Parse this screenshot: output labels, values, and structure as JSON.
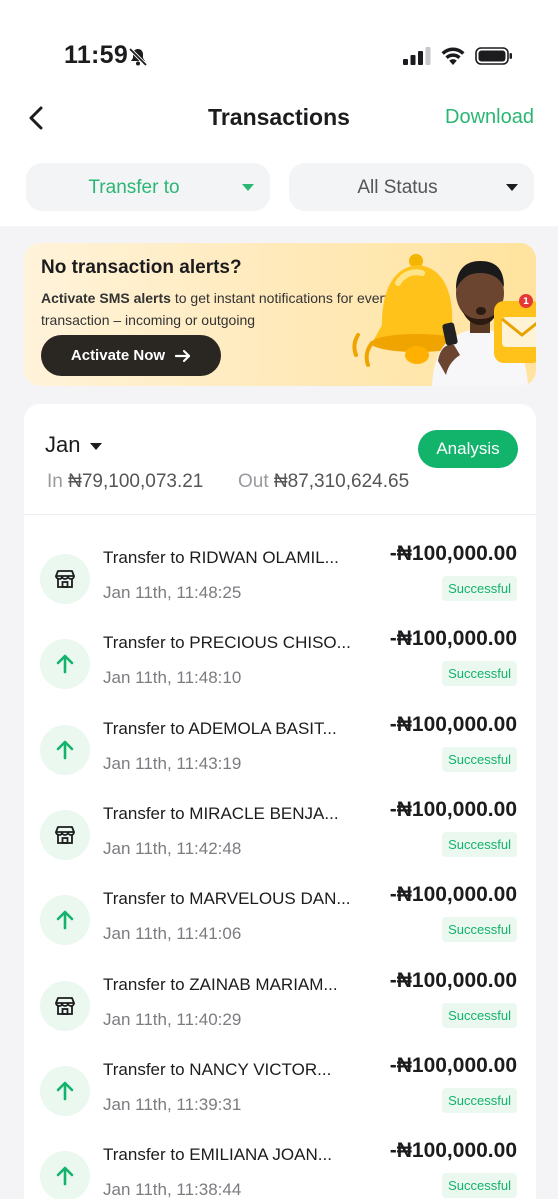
{
  "status_bar": {
    "time": "11:59"
  },
  "header": {
    "title": "Transactions",
    "download_label": "Download"
  },
  "filters": {
    "type": "Transfer to",
    "status": "All Status"
  },
  "banner": {
    "title": "No transaction alerts?",
    "text_bold": "Activate SMS alerts",
    "text_rest": " to get instant notifications for every transaction – incoming or outgoing",
    "button_label": "Activate Now",
    "badge_count": "1"
  },
  "summary": {
    "month": "Jan",
    "analysis_label": "Analysis",
    "in_label": "In",
    "in_value": "₦79,100,073.21",
    "out_label": "Out",
    "out_value": "₦87,310,624.65"
  },
  "transactions": [
    {
      "icon": "store-icon",
      "name": "Transfer to RIDWAN OLAMIL...",
      "time": "Jan 11th, 11:48:25",
      "amount": "-₦100,000.00",
      "status": "Successful"
    },
    {
      "icon": "arrow-up-icon",
      "name": "Transfer to PRECIOUS CHISO...",
      "time": "Jan 11th, 11:48:10",
      "amount": "-₦100,000.00",
      "status": "Successful"
    },
    {
      "icon": "arrow-up-icon",
      "name": "Transfer to ADEMOLA BASIT...",
      "time": "Jan 11th, 11:43:19",
      "amount": "-₦100,000.00",
      "status": "Successful"
    },
    {
      "icon": "store-icon",
      "name": "Transfer to MIRACLE BENJA...",
      "time": "Jan 11th, 11:42:48",
      "amount": "-₦100,000.00",
      "status": "Successful"
    },
    {
      "icon": "arrow-up-icon",
      "name": "Transfer to MARVELOUS DAN...",
      "time": "Jan 11th, 11:41:06",
      "amount": "-₦100,000.00",
      "status": "Successful"
    },
    {
      "icon": "store-icon",
      "name": "Transfer to ZAINAB MARIAM...",
      "time": "Jan 11th, 11:40:29",
      "amount": "-₦100,000.00",
      "status": "Successful"
    },
    {
      "icon": "arrow-up-icon",
      "name": "Transfer to NANCY VICTOR...",
      "time": "Jan 11th, 11:39:31",
      "amount": "-₦100,000.00",
      "status": "Successful"
    },
    {
      "icon": "arrow-up-icon",
      "name": "Transfer to EMILIANA JOAN...",
      "time": "Jan 11th, 11:38:44",
      "amount": "-₦100,000.00",
      "status": "Successful"
    }
  ],
  "colors": {
    "accent": "#12b36b",
    "accent_text": "#2bb673",
    "icon_bg": "#eaf8f0"
  }
}
